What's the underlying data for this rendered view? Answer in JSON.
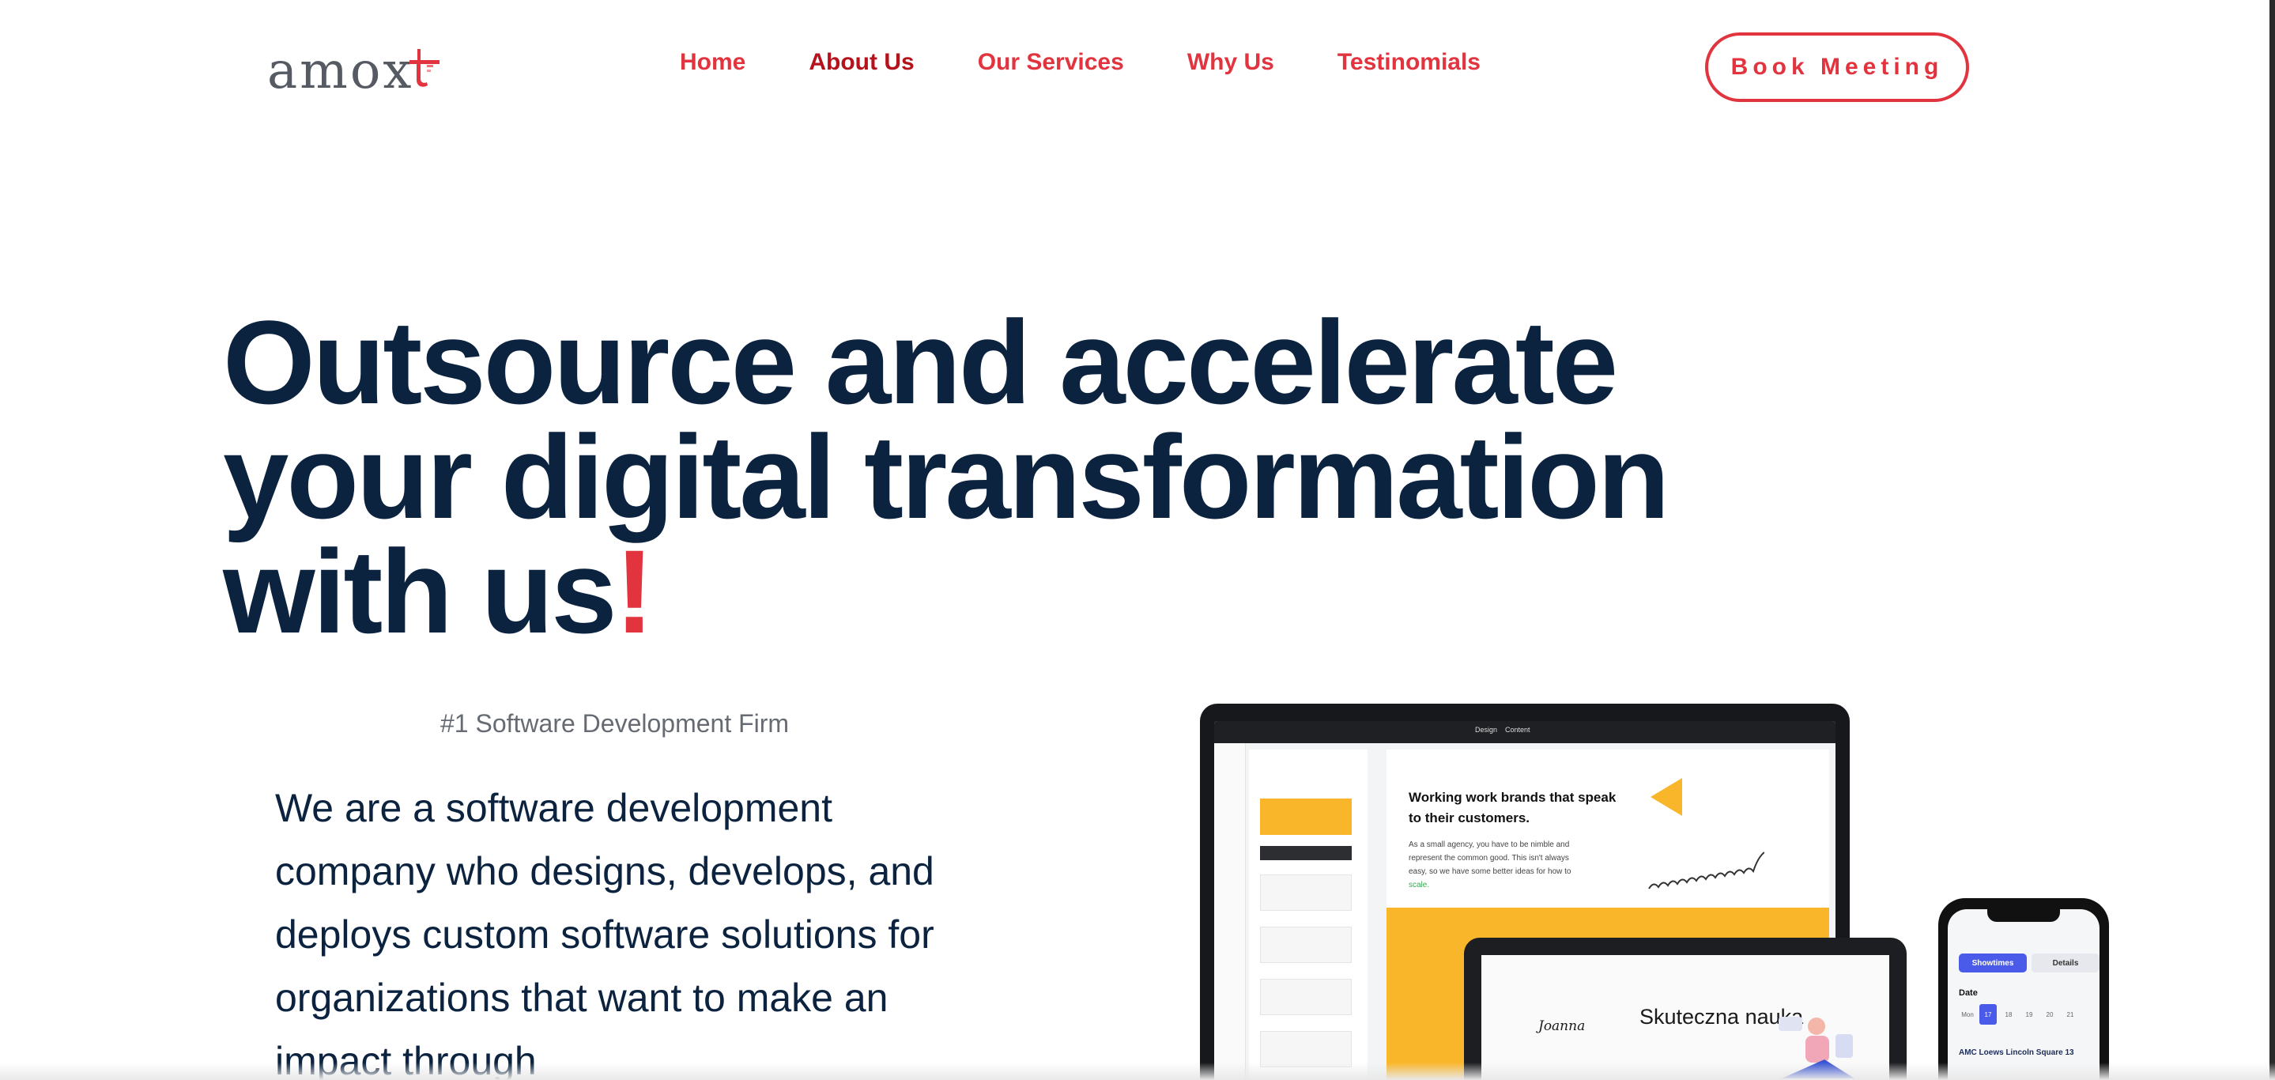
{
  "brand": {
    "logo_text": "amox",
    "accent_color": "#e1343f",
    "heading_color": "#0c2340"
  },
  "nav": {
    "items": [
      {
        "label": "Home"
      },
      {
        "label": "About Us"
      },
      {
        "label": "Our Services"
      },
      {
        "label": "Why Us"
      },
      {
        "label": "Testinomials"
      }
    ],
    "active": "About Us",
    "cta_label": "Book Meeting"
  },
  "hero": {
    "headline_line1": "Outsource and accelerate",
    "headline_line2": "your digital transformation",
    "headline_line3": "with us",
    "headline_mark": "!",
    "tagline": "#1 Software Development Firm",
    "intro": "We are a software development company who designs, develops, and deploys custom software solutions for organizations that want to make an impact through"
  },
  "mockup": {
    "laptop_title": "Working work brands that speak to their customers.",
    "laptop_body": "As a small agency, you have to be nimble and represent the common good. This isn't always easy, so we have some better ideas for how to",
    "laptop_link": "scale.",
    "toggle_design": "Design",
    "toggle_content": "Content",
    "tablet_title": "Skuteczna nauka",
    "tablet_name": "Joanna",
    "phone_tab_on": "Showtimes",
    "phone_tab_off": "Details",
    "phone_date_label": "Date",
    "phone_days": [
      "Mon",
      "17",
      "18",
      "19",
      "20",
      "21"
    ],
    "phone_venue": "AMC Loews Lincoln Square 13"
  }
}
